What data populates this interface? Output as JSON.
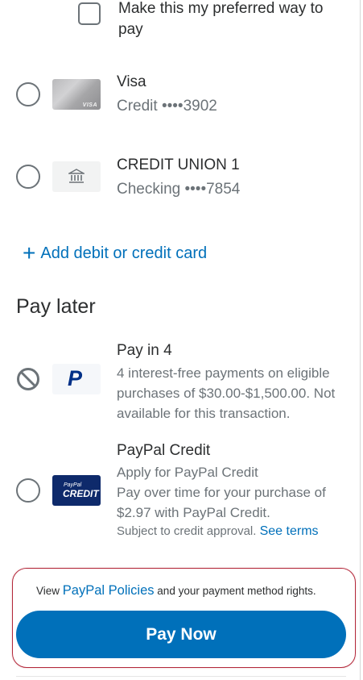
{
  "preferred": {
    "label": "Make this my preferred way to pay"
  },
  "methods": [
    {
      "title": "Visa",
      "subtitle": "Credit ••••3902",
      "logo_text": "VISA"
    },
    {
      "title": "CREDIT UNION 1",
      "subtitle": "Checking ••••7854"
    }
  ],
  "add_card": {
    "label": "Add debit or credit card"
  },
  "pay_later": {
    "heading": "Pay later",
    "pay_in_4": {
      "title": "Pay in 4",
      "description": "4 interest-free payments on eligible purchases of $30.00-$1,500.00. Not available for this transaction.",
      "logo_text": "P"
    },
    "credit": {
      "title": "PayPal Credit",
      "line1": "Apply for PayPal Credit",
      "line2": "Pay over time for your purchase of $2.97 with PayPal Credit.",
      "line3": "Subject to credit approval.",
      "see_terms": "See terms",
      "logo_line1": "PayPal",
      "logo_line2": "CREDIT"
    }
  },
  "footer": {
    "policy_prefix": "View",
    "policy_link": "PayPal Policies",
    "policy_suffix": "and your payment method rights.",
    "pay_button": "Pay Now"
  },
  "colors": {
    "accent": "#0070ba",
    "highlight_border": "#b3283a",
    "text": "#2c2e2f",
    "muted": "#6c7378"
  }
}
